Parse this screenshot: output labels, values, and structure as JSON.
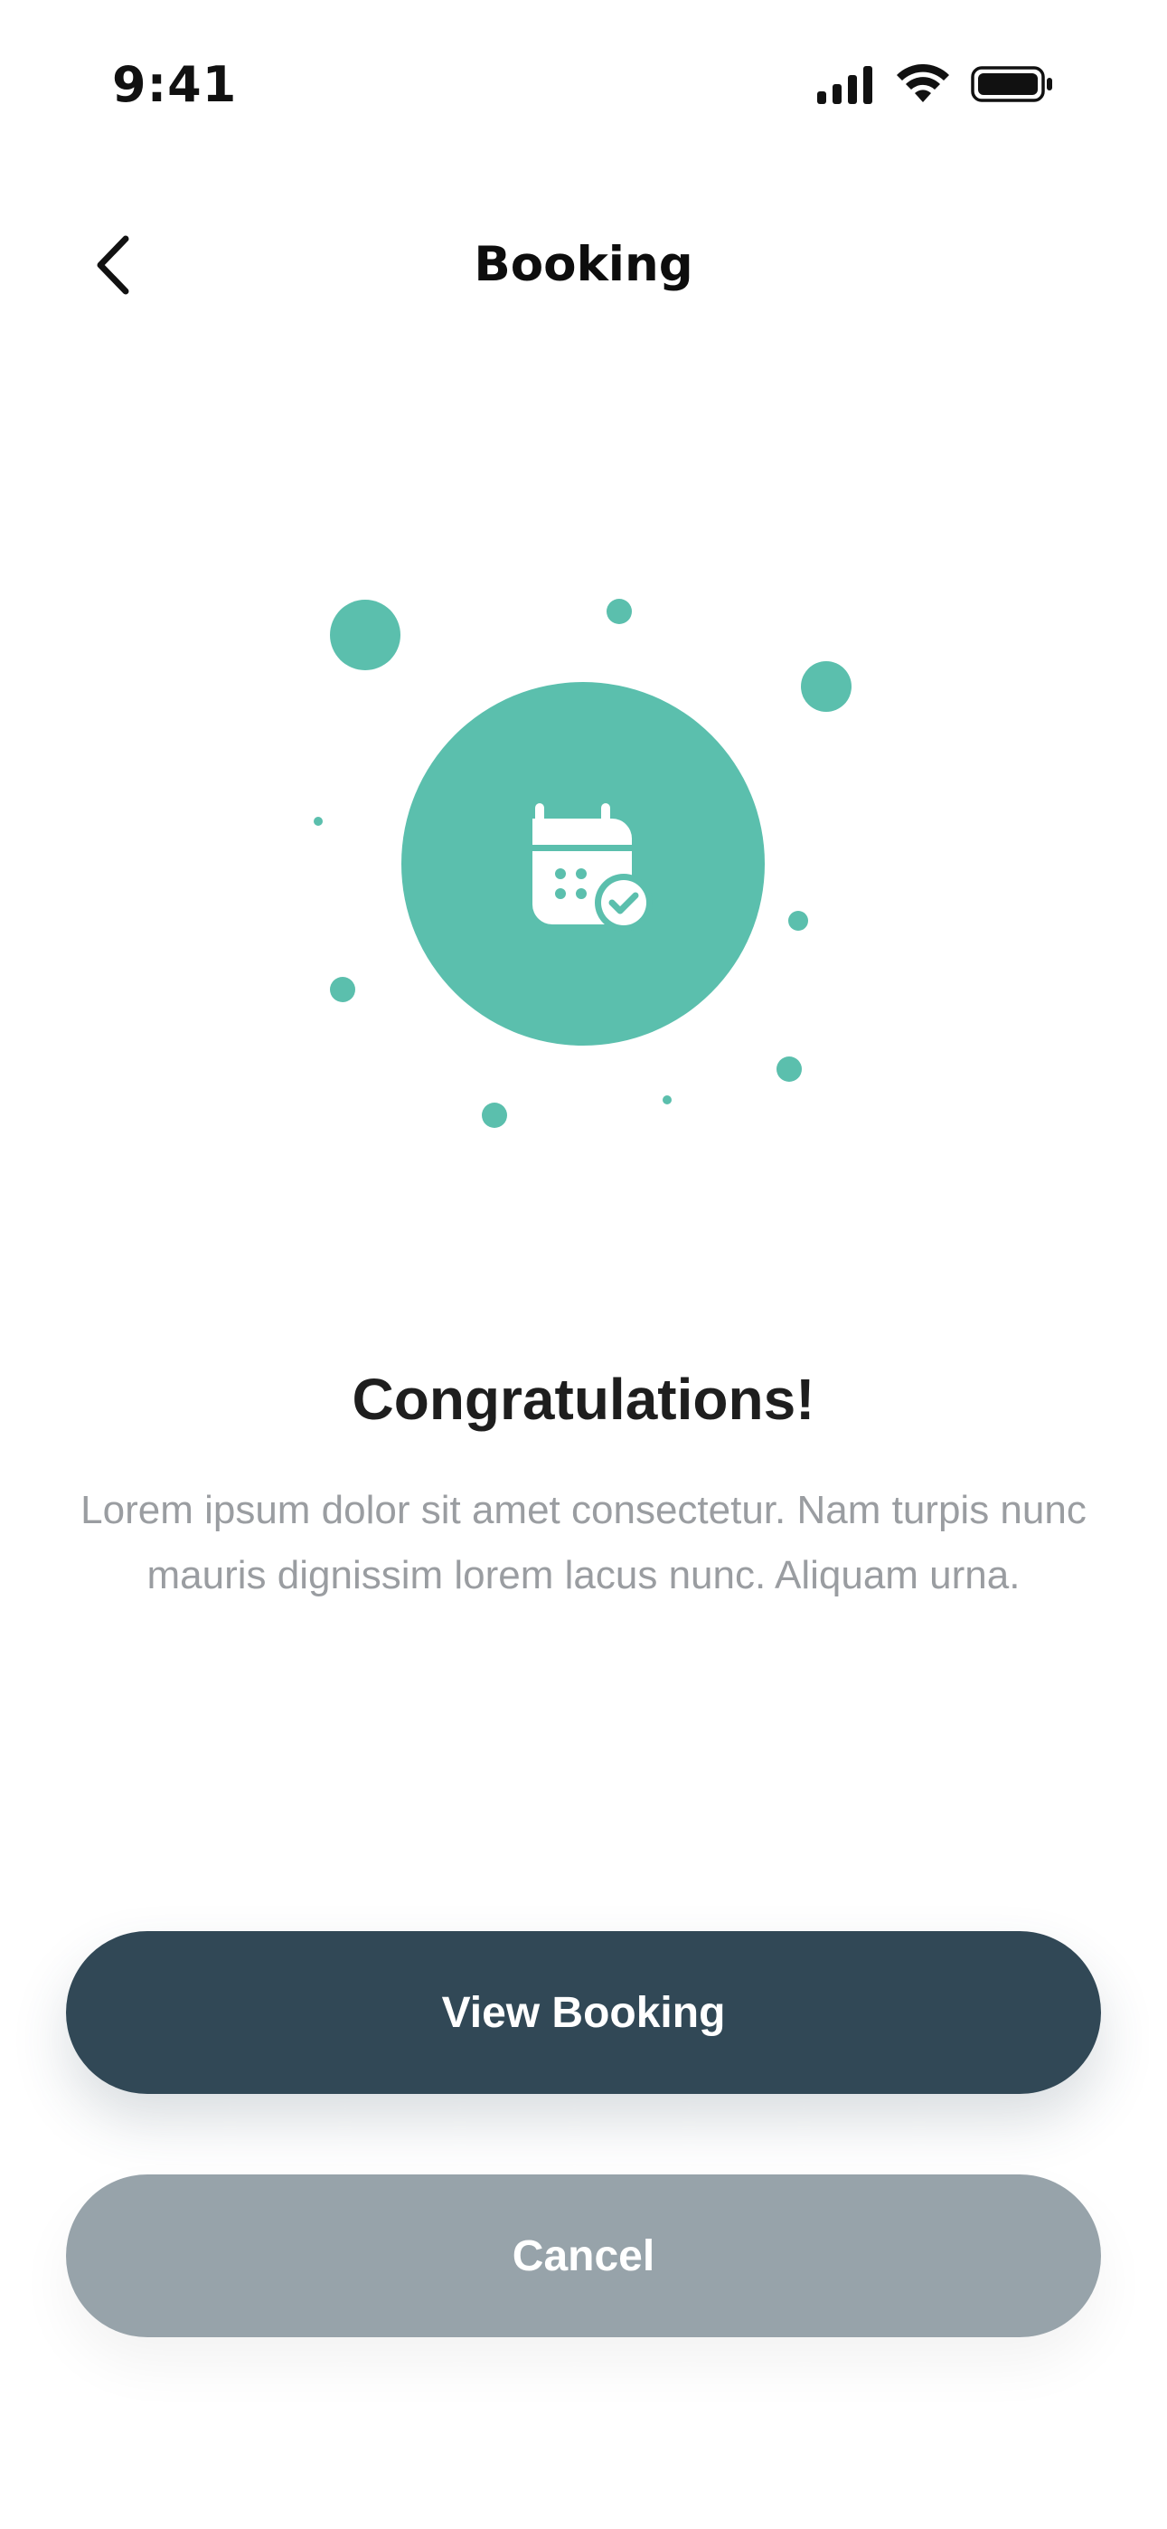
{
  "status_bar": {
    "time": "9:41",
    "icons": [
      "signal-icon",
      "wifi-icon",
      "battery-icon"
    ]
  },
  "nav": {
    "title": "Booking",
    "back_icon": "chevron-left-icon"
  },
  "illustration": {
    "icon": "calendar-check-icon",
    "accent_color": "#5BBFAD"
  },
  "content": {
    "headline": "Congratulations!",
    "body": "Lorem ipsum dolor sit amet consectetur. Nam turpis nunc mauris dignissim lorem lacus nunc. Aliquam urna."
  },
  "actions": {
    "primary_label": "View Booking",
    "secondary_label": "Cancel",
    "primary_color": "#314856",
    "secondary_color": "#97A3AA"
  }
}
